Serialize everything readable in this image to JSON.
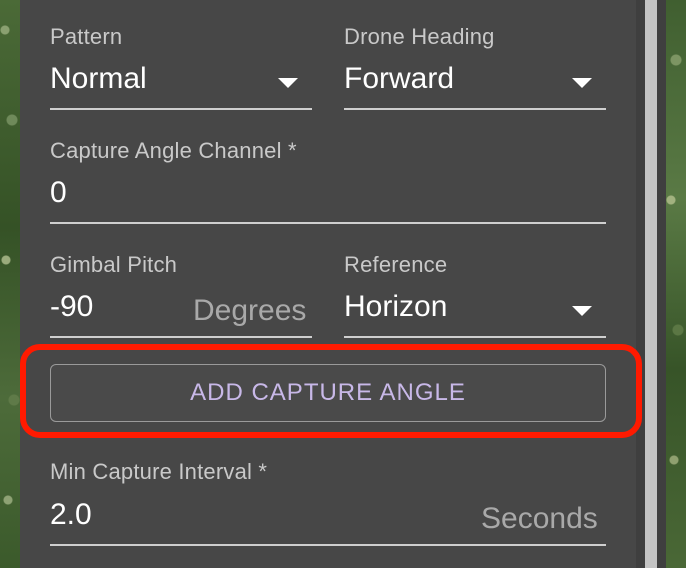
{
  "pattern": {
    "label": "Pattern",
    "value": "Normal"
  },
  "drone_heading": {
    "label": "Drone Heading",
    "value": "Forward"
  },
  "capture_angle_channel": {
    "label": "Capture Angle Channel *",
    "value": "0"
  },
  "gimbal_pitch": {
    "label": "Gimbal Pitch",
    "value": "-90",
    "unit": "Degrees"
  },
  "reference": {
    "label": "Reference",
    "value": "Horizon"
  },
  "add_capture_angle": {
    "label": "ADD CAPTURE ANGLE"
  },
  "min_capture_interval": {
    "label": "Min Capture Interval *",
    "value": "2.0",
    "unit": "Seconds"
  },
  "colors": {
    "panel_bg": "#474747",
    "highlight": "#ff1a00",
    "button_text": "#c8b8e8"
  },
  "icons": [
    "dropdown-caret-icon"
  ]
}
